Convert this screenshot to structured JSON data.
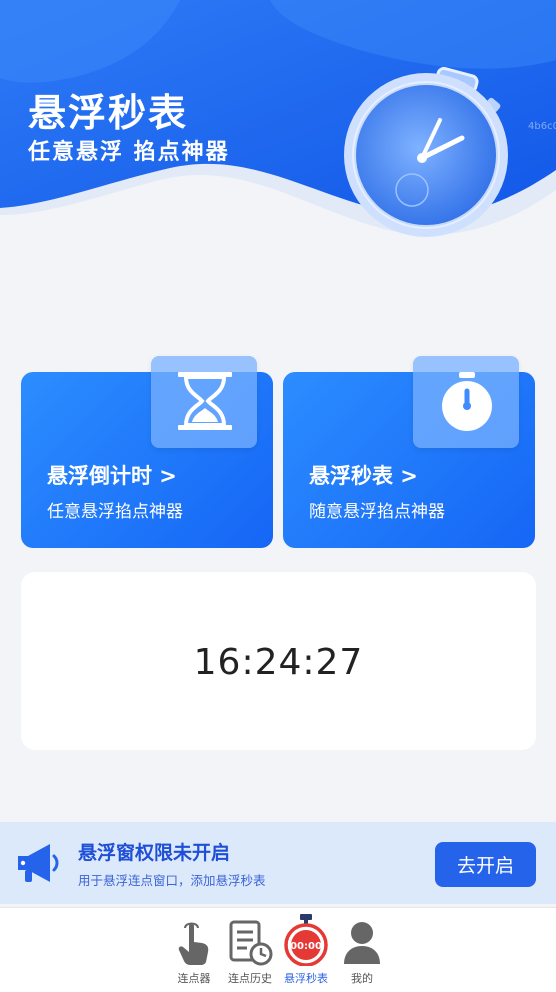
{
  "hero": {
    "title": "悬浮秒表",
    "subtitle": "任意悬浮  掐点神器",
    "watermark": "4b6c0"
  },
  "cards": [
    {
      "title": "悬浮倒计时 >",
      "subtitle": "任意悬浮掐点神器",
      "icon": "hourglass-icon"
    },
    {
      "title": "悬浮秒表 >",
      "subtitle": "随意悬浮掐点神器",
      "icon": "stopwatch-icon"
    }
  ],
  "clock": {
    "time": "16:24:27"
  },
  "permission": {
    "title": "悬浮窗权限未开启",
    "description": "用于悬浮连点窗口，添加悬浮秒表",
    "button": "去开启",
    "icon": "megaphone-icon"
  },
  "tabs": [
    {
      "label": "连点器",
      "icon": "tap-hand-icon"
    },
    {
      "label": "连点历史",
      "icon": "history-document-icon"
    },
    {
      "label": "悬浮秒表",
      "icon": "stopwatch-badge-icon",
      "badge": "00:00",
      "active": true
    },
    {
      "label": "我的",
      "icon": "person-icon"
    }
  ],
  "colors": {
    "hero_blue": "#1a66f0",
    "card_blue": "#1566f5",
    "accent": "#2563eb",
    "active_tab": "#2f63e6",
    "badge_red": "#e53935"
  }
}
